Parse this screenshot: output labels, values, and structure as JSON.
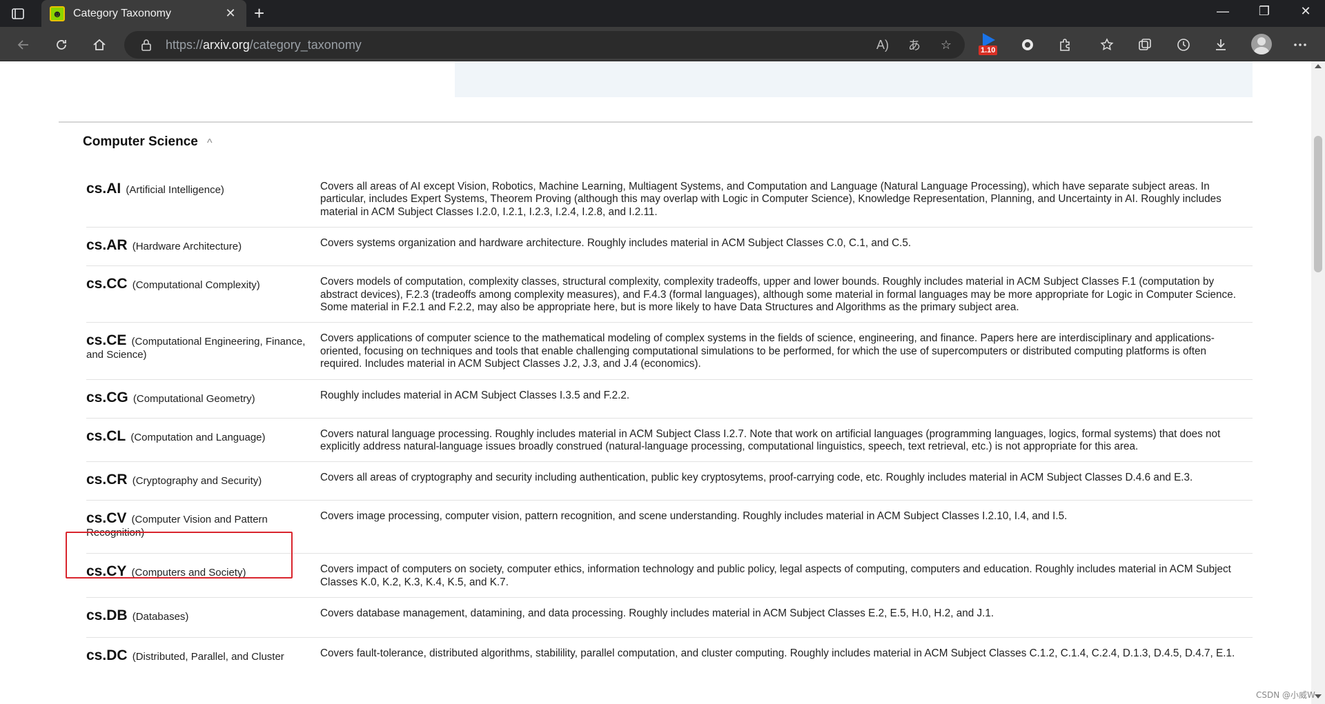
{
  "browser": {
    "tab_title": "Category Taxonomy",
    "tab_close": "✕",
    "new_tab": "+",
    "url_scheme": "https://",
    "url_host": "arxiv.org",
    "url_path": "/category_taxonomy",
    "extension_badge": "1.10",
    "window_controls": [
      "—",
      "❐",
      "✕"
    ]
  },
  "page": {
    "section_title": "Computer Science",
    "collapse_caret": "^",
    "watermark": "CSDN @小威W",
    "categories": [
      {
        "code": "cs.AI",
        "name": "(Artificial Intelligence)",
        "description": "Covers all areas of AI except Vision, Robotics, Machine Learning, Multiagent Systems, and Computation and Language (Natural Language Processing), which have separate subject areas. In particular, includes Expert Systems, Theorem Proving (although this may overlap with Logic in Computer Science), Knowledge Representation, Planning, and Uncertainty in AI. Roughly includes material in ACM Subject Classes I.2.0, I.2.1, I.2.3, I.2.4, I.2.8, and I.2.11."
      },
      {
        "code": "cs.AR",
        "name": "(Hardware Architecture)",
        "description": "Covers systems organization and hardware architecture. Roughly includes material in ACM Subject Classes C.0, C.1, and C.5."
      },
      {
        "code": "cs.CC",
        "name": "(Computational Complexity)",
        "description": "Covers models of computation, complexity classes, structural complexity, complexity tradeoffs, upper and lower bounds. Roughly includes material in ACM Subject Classes F.1 (computation by abstract devices), F.2.3 (tradeoffs among complexity measures), and F.4.3 (formal languages), although some material in formal languages may be more appropriate for Logic in Computer Science. Some material in F.2.1 and F.2.2, may also be appropriate here, but is more likely to have Data Structures and Algorithms as the primary subject area."
      },
      {
        "code": "cs.CE",
        "name": "(Computational Engineering, Finance, and Science)",
        "description": "Covers applications of computer science to the mathematical modeling of complex systems in the fields of science, engineering, and finance. Papers here are interdisciplinary and applications-oriented, focusing on techniques and tools that enable challenging computational simulations to be performed, for which the use of supercomputers or distributed computing platforms is often required. Includes material in ACM Subject Classes J.2, J.3, and J.4 (economics)."
      },
      {
        "code": "cs.CG",
        "name": "(Computational Geometry)",
        "description": "Roughly includes material in ACM Subject Classes I.3.5 and F.2.2."
      },
      {
        "code": "cs.CL",
        "name": "(Computation and Language)",
        "description": "Covers natural language processing. Roughly includes material in ACM Subject Class I.2.7. Note that work on artificial languages (programming languages, logics, formal systems) that does not explicitly address natural-language issues broadly construed (natural-language processing, computational linguistics, speech, text retrieval, etc.) is not appropriate for this area."
      },
      {
        "code": "cs.CR",
        "name": "(Cryptography and Security)",
        "description": "Covers all areas of cryptography and security including authentication, public key cryptosytems, proof-carrying code, etc. Roughly includes material in ACM Subject Classes D.4.6 and E.3."
      },
      {
        "code": "cs.CV",
        "name": "(Computer Vision and Pattern Recognition)",
        "description": "Covers image processing, computer vision, pattern recognition, and scene understanding. Roughly includes material in ACM Subject Classes I.2.10, I.4, and I.5."
      },
      {
        "code": "cs.CY",
        "name": "(Computers and Society)",
        "description": "Covers impact of computers on society, computer ethics, information technology and public policy, legal aspects of computing, computers and education. Roughly includes material in ACM Subject Classes K.0, K.2, K.3, K.4, K.5, and K.7."
      },
      {
        "code": "cs.DB",
        "name": "(Databases)",
        "description": "Covers database management, datamining, and data processing. Roughly includes material in ACM Subject Classes E.2, E.5, H.0, H.2, and J.1."
      },
      {
        "code": "cs.DC",
        "name": "(Distributed, Parallel, and Cluster",
        "description": "Covers fault-tolerance, distributed algorithms, stabilility, parallel computation, and cluster computing. Roughly includes material in ACM Subject Classes C.1.2, C.1.4, C.2.4, D.1.3, D.4.5, D.4.7, E.1."
      }
    ]
  }
}
